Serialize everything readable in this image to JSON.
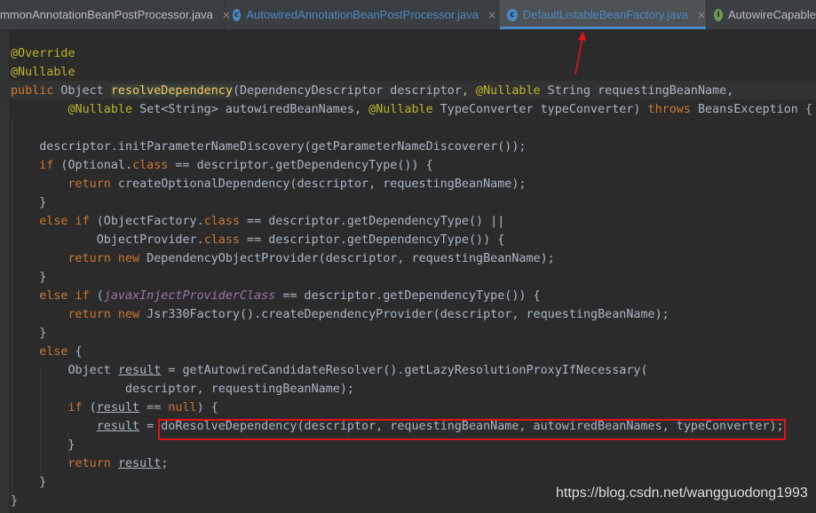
{
  "tabs": [
    {
      "label": "mmonAnnotationBeanPostProcessor.java",
      "icon": "close-icon",
      "active": false
    },
    {
      "label": "AutowiredAnnotationBeanPostProcessor.java",
      "icon": "class-c-icon",
      "active": false
    },
    {
      "label": "DefaultListableBeanFactory.java",
      "icon": "class-c-icon",
      "active": true
    },
    {
      "label": "AutowireCapable",
      "icon": "interface-i-icon",
      "active": false
    }
  ],
  "tab_close_glyph": "×",
  "class_glyph": "c",
  "interface_glyph": "I",
  "colors": {
    "class_icon": "#4a88c7",
    "interface_icon": "#6a9a54",
    "annotation_box": "#e3121b",
    "arrow": "#e3121b"
  },
  "code": {
    "l1": "@Override",
    "l2": "@Nullable",
    "l3_kw": "public",
    "l3_a": " Object ",
    "l3_method": "resolveDependency",
    "l3_b": "(DependencyDescriptor descriptor, ",
    "l3_ann": "@Nullable",
    "l3_c": " String requestingBeanName,",
    "l4_indent": "        ",
    "l4_ann1": "@Nullable",
    "l4_a": " Set<String> autowiredBeanNames, ",
    "l4_ann2": "@Nullable",
    "l4_b": " TypeConverter typeConverter) ",
    "l4_kw": "throws",
    "l4_c": " BeansException {",
    "l6": "    descriptor.initParameterNameDiscovery(getParameterNameDiscoverer());",
    "l7_indent": "    ",
    "l7_kw": "if",
    "l7_a": " (Optional.",
    "l7_kw2": "class",
    "l7_b": " == descriptor.getDependencyType()) {",
    "l8_indent": "        ",
    "l8_kw": "return",
    "l8_a": " createOptionalDependency(descriptor, requestingBeanName);",
    "l9": "    }",
    "l10_indent": "    ",
    "l10_kw": "else if",
    "l10_a": " (ObjectFactory.",
    "l10_kw2": "class",
    "l10_b": " == descriptor.getDependencyType() ||",
    "l11_indent": "            ",
    "l11_a": "ObjectProvider.",
    "l11_kw": "class",
    "l11_b": " == descriptor.getDependencyType()) {",
    "l12_indent": "        ",
    "l12_kw": "return new",
    "l12_a": " DependencyObjectProvider(descriptor, requestingBeanName);",
    "l13": "    }",
    "l14_indent": "    ",
    "l14_kw": "else if",
    "l14_a": " (",
    "l14_field": "javaxInjectProviderClass",
    "l14_b": " == descriptor.getDependencyType()) {",
    "l15_indent": "        ",
    "l15_kw": "return new",
    "l15_a": " Jsr330Factory().createDependencyProvider(descriptor, requestingBeanName);",
    "l16": "    }",
    "l17_indent": "    ",
    "l17_kw": "else",
    "l17_a": " {",
    "l18_a": "        Object ",
    "l18_var": "result",
    "l18_b": " = getAutowireCandidateResolver().getLazyResolutionProxyIfNecessary(",
    "l19": "                descriptor, requestingBeanName);",
    "l20_indent": "        ",
    "l20_kw": "if",
    "l20_a": " (",
    "l20_var": "result",
    "l20_b": " == ",
    "l20_kw2": "null",
    "l20_c": ") {",
    "l21_indent": "            ",
    "l21_var": "result",
    "l21_a": " = doResolveDependency(descriptor, requestingBeanName, autowiredBeanNames, typeConverter);",
    "l22": "        }",
    "l23_indent": "        ",
    "l23_kw": "return",
    "l23_a": " ",
    "l23_var": "result",
    "l23_b": ";",
    "l24": "    }",
    "l25": "}"
  },
  "watermark": "https://blog.csdn.net/wangguodong1993"
}
